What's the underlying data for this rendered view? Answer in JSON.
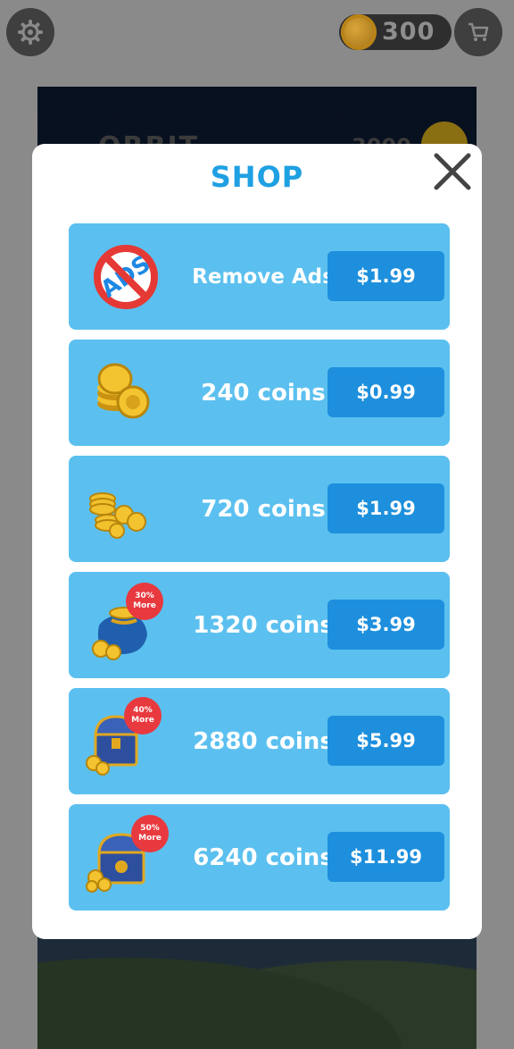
{
  "header": {
    "coin_balance": "300"
  },
  "background": {
    "title_peek": "ORBIT",
    "score_peek": "3000"
  },
  "shop": {
    "title": "SHOP",
    "close_icon": "close-x-icon",
    "items": [
      {
        "label": "Remove Ads",
        "price": "$1.99",
        "icon": "no-ads-icon",
        "badge": null
      },
      {
        "label": "240 coins",
        "price": "$0.99",
        "icon": "coin-stack-small-icon",
        "badge": null
      },
      {
        "label": "720 coins",
        "price": "$1.99",
        "icon": "coin-pile-icon",
        "badge": null
      },
      {
        "label": "1320 coins",
        "price": "$3.99",
        "icon": "coin-bag-icon",
        "badge": {
          "pct": "30%",
          "more": "More"
        }
      },
      {
        "label": "2880 coins",
        "price": "$5.99",
        "icon": "treasure-chest-icon",
        "badge": {
          "pct": "40%",
          "more": "More"
        }
      },
      {
        "label": "6240 coins",
        "price": "$11.99",
        "icon": "treasure-chest-large-icon",
        "badge": {
          "pct": "50%",
          "more": "More"
        }
      }
    ]
  },
  "colors": {
    "title_blue": "#1fa0e2",
    "row_bg": "#5bc0ef",
    "price_btn": "#1d8fdd",
    "badge_red": "#e8393f"
  }
}
